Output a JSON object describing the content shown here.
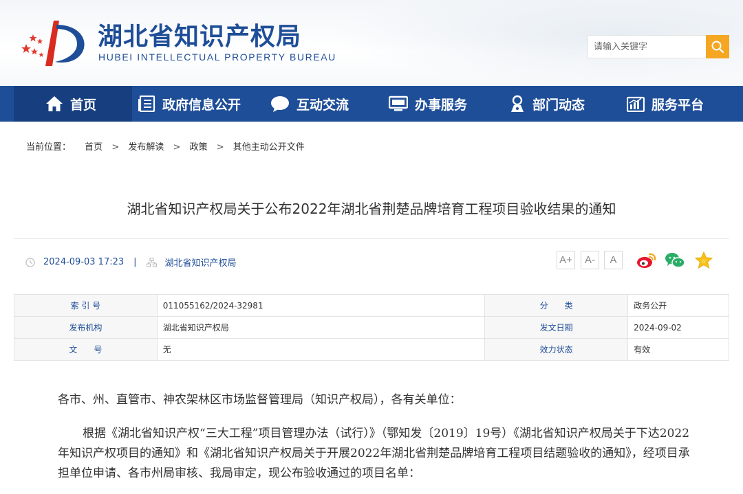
{
  "header": {
    "site_title": "湖北省知识产权局",
    "site_subtitle": "HUBEI INTELLECTUAL PROPERTY BUREAU",
    "search_placeholder": "请输入关键字",
    "search_icon": "search-icon",
    "brand_color": "#1f4e98",
    "accent_color": "#f5a623"
  },
  "nav": {
    "items": [
      {
        "label": "首页",
        "icon": "home-icon",
        "active": true
      },
      {
        "label": "政府信息公开",
        "icon": "document-icon"
      },
      {
        "label": "互动交流",
        "icon": "chat-bubble-icon"
      },
      {
        "label": "办事服务",
        "icon": "monitor-icon"
      },
      {
        "label": "部门动态",
        "icon": "person-pin-icon"
      },
      {
        "label": "服务平台",
        "icon": "bar-chart-icon"
      }
    ]
  },
  "breadcrumb": {
    "label": "当前位置：",
    "items": [
      "首页",
      "发布解读",
      "政策",
      "其他主动公开文件"
    ],
    "separator": ">"
  },
  "article": {
    "title": "湖北省知识产权局关于公布2022年湖北省荆楚品牌培育工程项目验收结果的通知",
    "date": "2024-09-03 17:23",
    "divider": "|",
    "source": "湖北省知识产权局",
    "font_sizes": [
      "A+",
      "A-",
      "A"
    ],
    "share": [
      "weibo-icon",
      "wechat-icon",
      "favorite-star-icon"
    ]
  },
  "info": {
    "rows": [
      {
        "k1": "索 引 号",
        "v1": "011055162/2024-32981",
        "k2": "分　　类",
        "v2": "政务公开"
      },
      {
        "k1": "发布机构",
        "v1": "湖北省知识产权局",
        "k2": "发文日期",
        "v2": "2024-09-02"
      },
      {
        "k1": "文　　号",
        "v1": "无",
        "k2": "效力状态",
        "v2": "有效"
      }
    ]
  },
  "body": {
    "p1": "各市、州、直管市、神农架林区市场监督管理局（知识产权局），各有关单位：",
    "p2": "根据《湖北省知识产权“三大工程”项目管理办法（试行）》（鄂知发〔2019〕19号）《湖北省知识产权局关于下达2022年知识产权项目的通知》和《湖北省知识产权局关于开展2022年湖北省荆楚品牌培育工程项目结题验收的通知》，经项目承担单位申请、各市州局审核、我局审定，现公布验收通过的项目名单："
  }
}
